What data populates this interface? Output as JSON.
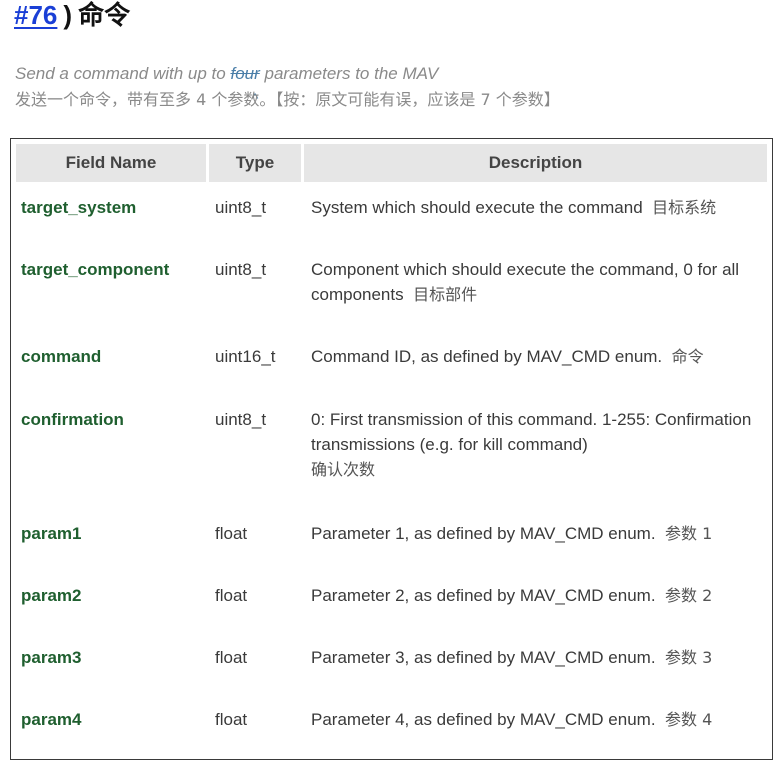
{
  "heading": {
    "anchor": "#76",
    "paren": ")",
    "title": "命令"
  },
  "summary": {
    "en_before": "Send a command with up to ",
    "en_struck": "four",
    "en_caret": "^",
    "en_after": " parameters to the MAV",
    "cn": "发送一个命令，带有至多 4 个参数。【按：原文可能有误，应该是 7 个参数】"
  },
  "table": {
    "headers": {
      "name": "Field Name",
      "type": "Type",
      "description": "Description"
    },
    "rows": [
      {
        "name": "target_system",
        "type": "uint8_t",
        "desc": "System which should execute the command",
        "desc_cn": "目标系统"
      },
      {
        "name": "target_component",
        "type": "uint8_t",
        "desc": "Component which should execute the command, 0 for all components",
        "desc_cn": "目标部件"
      },
      {
        "name": "command",
        "type": "uint16_t",
        "desc": "Command ID, as defined by MAV_CMD enum.",
        "desc_cn": "命令"
      },
      {
        "name": "confirmation",
        "type": "uint8_t",
        "desc": "0: First transmission of this command. 1-255: Confirmation transmissions (e.g. for kill command)",
        "desc_cn": "确认次数"
      },
      {
        "name": "param1",
        "type": "float",
        "desc": "Parameter 1, as defined by MAV_CMD enum.",
        "desc_cn": "参数 1"
      },
      {
        "name": "param2",
        "type": "float",
        "desc": "Parameter 2, as defined by MAV_CMD enum.",
        "desc_cn": "参数 2"
      },
      {
        "name": "param3",
        "type": "float",
        "desc": "Parameter 3, as defined by MAV_CMD enum.",
        "desc_cn": "参数 3"
      },
      {
        "name": "param4",
        "type": "float",
        "desc": "Parameter 4, as defined by MAV_CMD enum.",
        "desc_cn": "参数 4"
      }
    ]
  },
  "colors": {
    "anchor": "#1a3fd6",
    "field_name": "#1f5f2f",
    "header_bg": "#e6e6e6",
    "summary_gray": "#8a8a8a",
    "correction": "#4a7ea8"
  }
}
